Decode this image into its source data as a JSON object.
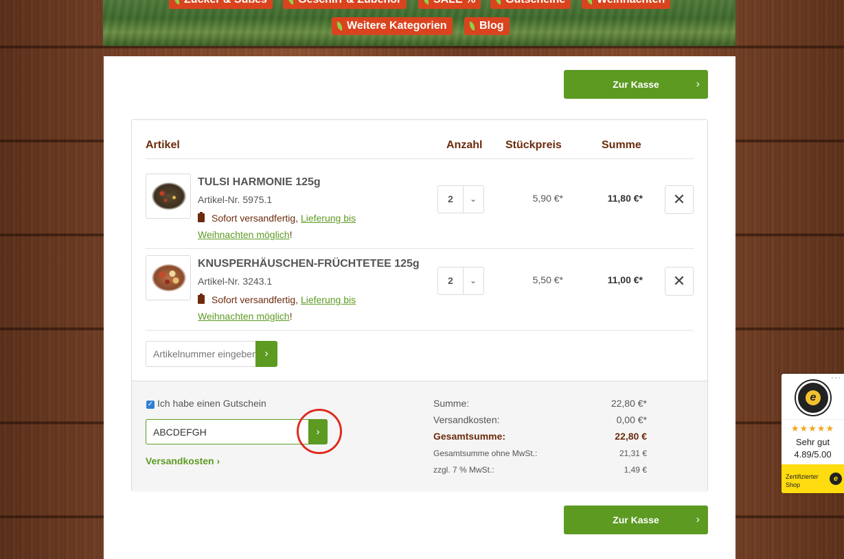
{
  "nav": {
    "items": [
      {
        "label": "Zucker & Süßes"
      },
      {
        "label": "Geschirr & Zubehör"
      },
      {
        "label": "SALE %"
      },
      {
        "label": "Gutscheine"
      },
      {
        "label": "Weihnachten"
      },
      {
        "label": "Weitere Kategorien"
      },
      {
        "label": "Blog"
      }
    ]
  },
  "checkout": {
    "label": "Zur Kasse",
    "chevron": "›"
  },
  "cart": {
    "headers": {
      "article": "Artikel",
      "quantity": "Anzahl",
      "unit_price": "Stückpreis",
      "total": "Summe"
    },
    "items": [
      {
        "title": "TULSI HARMONIE 125g",
        "article_no": "Artikel-Nr. 5975.1",
        "ship_text": "Sofort versandfertig, ",
        "ship_link": "Lieferung bis Weihnachten möglich",
        "ship_end": "!",
        "quantity": "2",
        "unit_price": "5,90 €*",
        "total": "11,80 €*"
      },
      {
        "title": "KNUSPERHÄUSCHEN-FRÜCHTETEE 125g",
        "article_no": "Artikel-Nr. 3243.1",
        "ship_text": "Sofort versandfertig, ",
        "ship_link": "Lieferung bis Weihnachten möglich",
        "ship_end": "!",
        "quantity": "2",
        "unit_price": "5,50 €*",
        "total": "11,00 €*"
      }
    ],
    "remove_glyph": "✕",
    "quantity_chevron": "⌄",
    "add_article": {
      "placeholder": "Artikelnummer eingeben...",
      "button": "›"
    }
  },
  "voucher": {
    "checked": true,
    "check_glyph": "✓",
    "label": "Ich habe einen Gutschein",
    "value": "ABCDEFGH",
    "button": "›",
    "shipping_link": "Versandkosten ›"
  },
  "totals": {
    "sum_label": "Summe:",
    "sum_value": "22,80 €*",
    "shipping_label": "Versandkosten:",
    "shipping_value": "0,00 €*",
    "grand_label": "Gesamtsumme:",
    "grand_value": "22,80 €",
    "net_label": "Gesamtsumme ohne MwSt.:",
    "net_value": "21,31 €",
    "vat_label": "zzgl. 7 % MwSt.:",
    "vat_value": "1,49 €"
  },
  "trusted": {
    "dots": "···",
    "seal_letter": "e",
    "stars": "★★★★★",
    "rating_label": "Sehr gut",
    "score": "4.89/5.00",
    "footer": "Zertifizierter Shop",
    "footer_icon": "e"
  },
  "colors": {
    "accent": "#5c9a22",
    "nav_pill": "#d9441e",
    "heading": "#6b2b0c",
    "highlight_ring": "#e02a1e"
  }
}
